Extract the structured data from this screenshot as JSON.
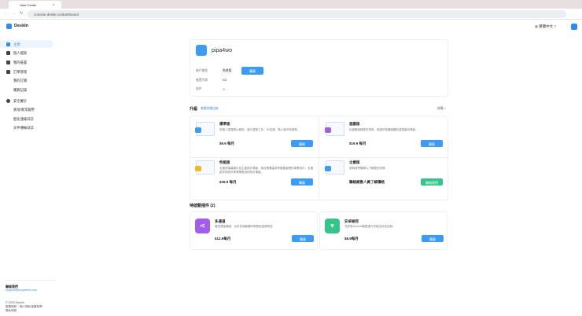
{
  "browser": {
    "tab_title": "User Center",
    "url": "console.deskin.io/dashboard"
  },
  "brand": "DeskIn",
  "language": "繁體中文",
  "sidebar": {
    "items": [
      {
        "label": "主頁",
        "active": true
      },
      {
        "label": "個人檔案"
      },
      {
        "label": "我的裝置"
      },
      {
        "label": "訂單管理"
      },
      {
        "label": "我的訂閱"
      },
      {
        "label": "購買記錄"
      },
      {
        "label": "安全審計"
      },
      {
        "label": "異地/異常報警"
      },
      {
        "label": "歷史連線日誌"
      },
      {
        "label": "文件傳輸日誌"
      }
    ],
    "contact_title": "聯絡我們",
    "contact_email": "support@zuoyetech.com",
    "copyright": "© 2025 DeskIn",
    "terms": "服務條款｜個人隱私保護政策",
    "privacy": "隱私條款"
  },
  "account": {
    "username": "pipa4wo",
    "type_label": "帳戶類型",
    "type_value": "免費版",
    "buy": "購買",
    "devices_label": "裝置列表",
    "devices_value": "2/3",
    "plugins_label": "插件",
    "plugins_value": "--"
  },
  "upgrade": {
    "title": "升級",
    "compare": "查看詳細比較",
    "details": "詳情 >",
    "plans": [
      {
        "name": "標準版",
        "desc": "供個人遠端辦公使用，進行遠程工作，2K支援，無人值守存取等。",
        "price": "$9.9 每月",
        "button": "購買",
        "color": "#3a9cf5"
      },
      {
        "name": "遊戲版",
        "desc": "玩遊戲追蹤更多資訊，適用於各種遊戲的遠端遊玩場景。",
        "price": "$19.9 每月",
        "button": "購買",
        "color": "#a25ee8"
      },
      {
        "name": "性能版",
        "desc": "支援多螢幕顯示及生產設計場景，適合需要高效率圖像處理的專業用戶，支援創作和設計等專業應用的設計場景。",
        "price": "$39.9 每月",
        "button": "購買",
        "color": "#f2b82c"
      },
      {
        "name": "企業版",
        "desc": "請與我們聯繫以了解更多詳情",
        "price": "聯絡銷售人員了解價格",
        "button": "聯絡我們",
        "color": "#3a9cf5"
      }
    ]
  },
  "plugins": {
    "title": "待啟動插件 (2)",
    "items": [
      {
        "name": "多通道",
        "desc": "增加連接通道，允許多個裝置同時發起遠端會話",
        "price": "$12.9每月",
        "button": "購買",
        "color": "#a25ee8"
      },
      {
        "name": "安卓被控",
        "desc": "允許對Android裝置進行存取及完全控制。",
        "price": "$8.9每月",
        "button": "購買",
        "color": "#35c48a"
      }
    ]
  }
}
